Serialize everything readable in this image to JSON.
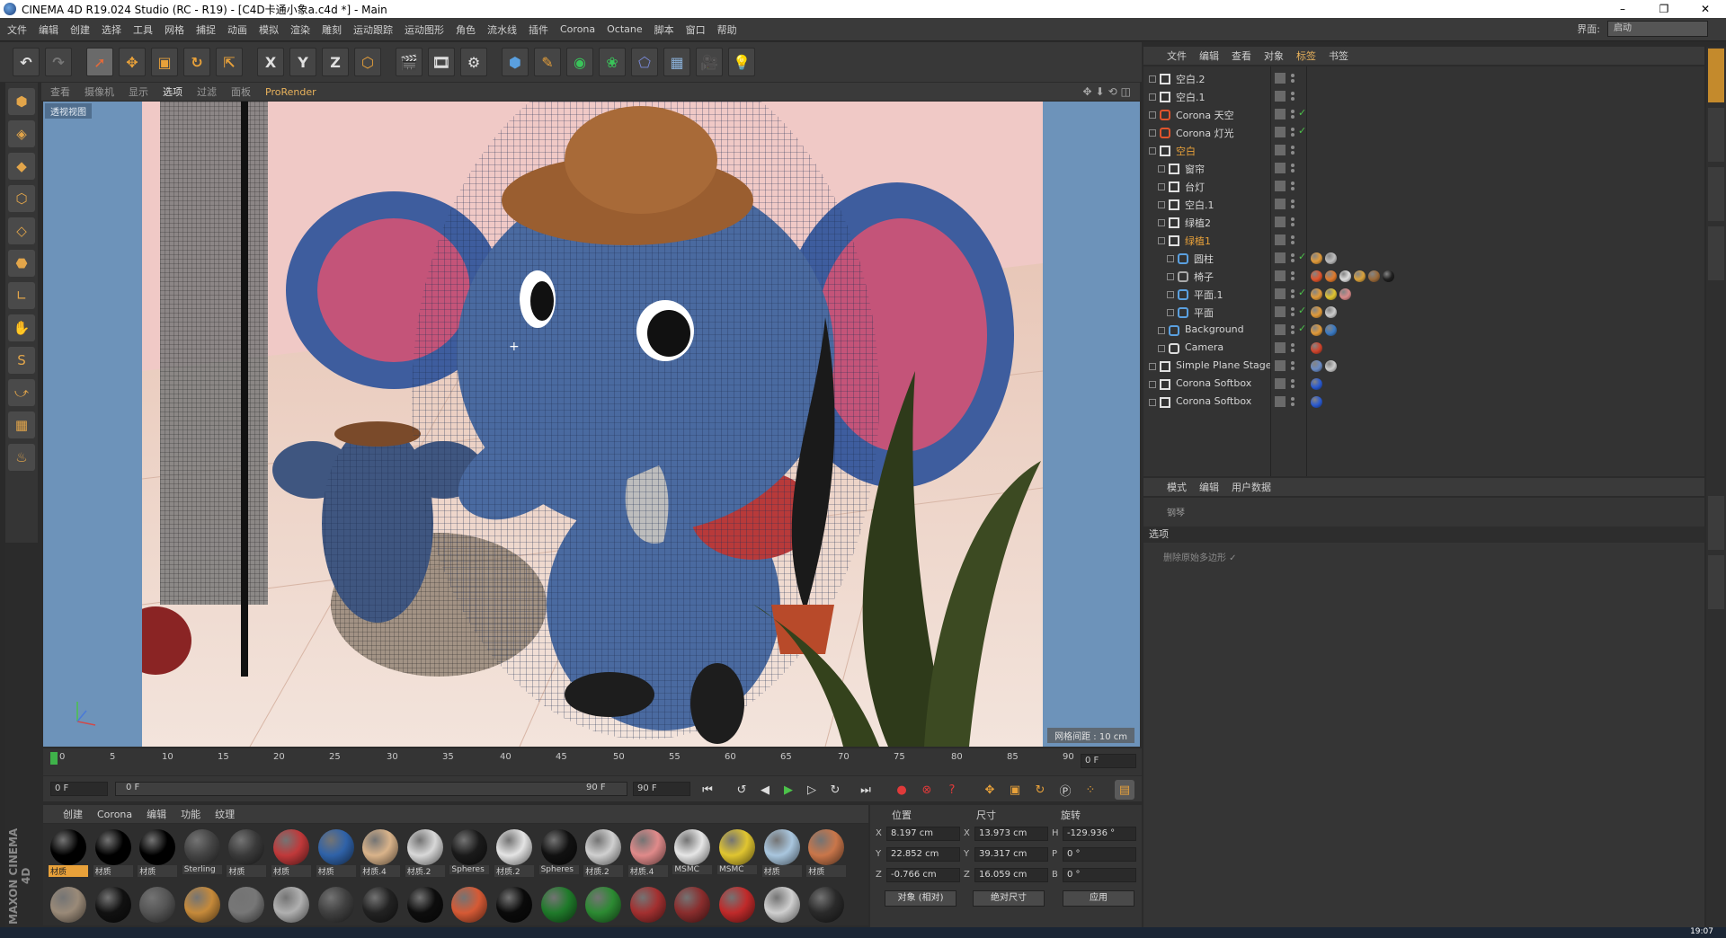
{
  "window": {
    "title": "CINEMA 4D R19.024 Studio (RC - R19) - [C4D卡通小象a.c4d *] - Main",
    "controls": [
      "–",
      "❐",
      "✕"
    ]
  },
  "menubar": {
    "items": [
      "文件",
      "编辑",
      "创建",
      "选择",
      "工具",
      "网格",
      "捕捉",
      "动画",
      "模拟",
      "渲染",
      "雕刻",
      "运动跟踪",
      "运动图形",
      "角色",
      "流水线",
      "插件",
      "Corona",
      "Octane",
      "脚本",
      "窗口",
      "帮助"
    ],
    "layout_label": "界面:",
    "layout_value": "启动"
  },
  "toolbar": {
    "buttons": [
      "↶",
      "↷",
      "➚",
      "✥",
      "▣",
      "↻",
      "⇱",
      "X",
      "Y",
      "Z",
      "⬡",
      "🎬",
      "🎞",
      "⚙",
      "⬢",
      "✎",
      "◉",
      "❀",
      "⬠",
      "▦",
      "🎥",
      "💡"
    ]
  },
  "left_tools": [
    "⬢",
    "◈",
    "◆",
    "⬡",
    "◇",
    "⬣",
    "∟",
    "✋",
    "S",
    "⤻",
    "▦",
    "♨"
  ],
  "viewport": {
    "menu": [
      "查看",
      "摄像机",
      "显示",
      "选项",
      "过滤",
      "面板",
      "ProRender"
    ],
    "active_menu": "选项",
    "label": "透视视图",
    "grid_info": "网格间距 : 10 cm",
    "nav_icons": "✥⬇⟲◫"
  },
  "timeline": {
    "ticks": [
      "0",
      "5",
      "10",
      "15",
      "20",
      "25",
      "30",
      "35",
      "40",
      "45",
      "50",
      "55",
      "60",
      "65",
      "70",
      "75",
      "80",
      "85",
      "90"
    ],
    "current_frame": "0 F"
  },
  "playback": {
    "start_field": "0 F",
    "range_start": "0 F",
    "range_end": "90 F",
    "end_field": "90 F"
  },
  "material_manager": {
    "tabs": [
      "创建",
      "Corona",
      "编辑",
      "功能",
      "纹理"
    ],
    "materials": [
      {
        "name": "材质",
        "color": "#000000",
        "selected": true
      },
      {
        "name": "材质",
        "color": "#000000",
        "selected": false
      },
      {
        "name": "材质",
        "color": "#000000",
        "selected": false
      },
      {
        "name": "Sterling",
        "color": "#444444",
        "selected": false
      },
      {
        "name": "材质",
        "color": "#3a3a3a",
        "selected": false
      },
      {
        "name": "材质",
        "color": "#c0393a",
        "selected": false
      },
      {
        "name": "材质",
        "color": "#2f62a8",
        "selected": false
      },
      {
        "name": "材质.4",
        "color": "#d9b38a",
        "selected": false
      },
      {
        "name": "材质.2",
        "color": "#d8d8d8",
        "selected": false
      },
      {
        "name": "Spheres",
        "color": "#1a1a1a",
        "selected": false
      },
      {
        "name": "材质.2",
        "color": "#e4e4e4",
        "selected": false
      },
      {
        "name": "Spheres",
        "color": "#111111",
        "selected": false
      },
      {
        "name": "材质.2",
        "color": "#d0d0d0",
        "selected": false
      },
      {
        "name": "材质.4",
        "color": "#e08a8a",
        "selected": false
      },
      {
        "name": "MSMC",
        "color": "#e6e6e6",
        "selected": false
      },
      {
        "name": "MSMC",
        "color": "#e0c530",
        "selected": false
      },
      {
        "name": "材质",
        "color": "#a9c6de",
        "selected": false
      },
      {
        "name": "材质",
        "color": "#c9764a",
        "selected": false
      }
    ],
    "second_row_colors": [
      "#9a8a78",
      "#111111",
      "#555555",
      "#c68a3a",
      "#777777",
      "#b0b0b0",
      "#404040",
      "#222222",
      "#0d0d0d",
      "#d65a35",
      "#0a0a0a",
      "#1f7a2a",
      "#2c8a32",
      "#a33030",
      "#8a2d2d",
      "#c02a2a",
      "#cfcfcf",
      "#2a2a2a"
    ],
    "brand": "MAXON CINEMA 4D"
  },
  "coordinates": {
    "headers": {
      "position": "位置",
      "size": "尺寸",
      "rotation": "旋转"
    },
    "rows": [
      {
        "label": "X",
        "position": "8.197 cm",
        "size_label": "X",
        "size": "13.973 cm",
        "rot_label": "H",
        "rotation": "-129.936 °"
      },
      {
        "label": "Y",
        "position": "22.852 cm",
        "size_label": "Y",
        "size": "39.317 cm",
        "rot_label": "P",
        "rotation": "0 °"
      },
      {
        "label": "Z",
        "position": "-0.766 cm",
        "size_label": "Z",
        "size": "16.059 cm",
        "rot_label": "B",
        "rotation": "0 °"
      }
    ],
    "mode_select": "对象 (相对)",
    "size_select": "绝对尺寸",
    "apply_button": "应用"
  },
  "object_manager": {
    "tabs": [
      "文件",
      "编辑",
      "查看",
      "对象",
      "标签",
      "书签"
    ],
    "active_tab": "标签",
    "objects": [
      {
        "name": "空白.2",
        "indent": 0,
        "icon": "null-icon",
        "selected": false,
        "tick": false,
        "tags": []
      },
      {
        "name": "空白.1",
        "indent": 0,
        "icon": "null-icon",
        "selected": false,
        "tick": false,
        "tags": []
      },
      {
        "name": "Corona 天空",
        "indent": 0,
        "icon": "sky-icon",
        "selected": false,
        "tick": true,
        "tags": []
      },
      {
        "name": "Corona 灯光",
        "indent": 0,
        "icon": "light-icon",
        "selected": false,
        "tick": true,
        "tags": []
      },
      {
        "name": "空白",
        "indent": 0,
        "icon": "null-icon",
        "selected": true,
        "tick": false,
        "tags": []
      },
      {
        "name": "窗帘",
        "indent": 1,
        "icon": "null-icon",
        "selected": false,
        "tick": false,
        "tags": []
      },
      {
        "name": "台灯",
        "indent": 1,
        "icon": "null-icon",
        "selected": false,
        "tick": false,
        "tags": []
      },
      {
        "name": "空白.1",
        "indent": 1,
        "icon": "null-icon",
        "selected": false,
        "tick": false,
        "tags": []
      },
      {
        "name": "绿植2",
        "indent": 1,
        "icon": "null-icon",
        "selected": false,
        "tick": false,
        "tags": []
      },
      {
        "name": "绿植1",
        "indent": 1,
        "icon": "null-icon",
        "selected": true,
        "tick": false,
        "tags": []
      },
      {
        "name": "圆柱",
        "indent": 2,
        "icon": "cylinder-icon",
        "selected": false,
        "tick": true,
        "tags": [
          "#e09a3a",
          "#bdbdbd"
        ]
      },
      {
        "name": "椅子",
        "indent": 2,
        "icon": "bone-icon",
        "selected": false,
        "tick": false,
        "tags": [
          "#e0542c",
          "#e07a2c",
          "#dddddd",
          "#d9a13a",
          "#9a6a3a",
          "#1e1e1e"
        ]
      },
      {
        "name": "平面.1",
        "indent": 2,
        "icon": "plane-icon",
        "selected": false,
        "tick": true,
        "tags": [
          "#e09a3a",
          "#e0c530",
          "#d88a8a"
        ]
      },
      {
        "name": "平面",
        "indent": 2,
        "icon": "plane-icon",
        "selected": false,
        "tick": true,
        "tags": [
          "#e09a3a",
          "#cccccc"
        ]
      },
      {
        "name": "Background",
        "indent": 1,
        "icon": "background-icon",
        "selected": false,
        "tick": true,
        "tags": [
          "#e09a3a",
          "#3a7ac4"
        ]
      },
      {
        "name": "Camera",
        "indent": 1,
        "icon": "camera-icon",
        "selected": false,
        "tick": false,
        "tags": [
          "#d0442c"
        ]
      },
      {
        "name": "Simple Plane Stage",
        "indent": 0,
        "icon": "null-icon",
        "selected": false,
        "tick": false,
        "tags": [
          "#6a8ac4",
          "#cccccc"
        ]
      },
      {
        "name": "Corona Softbox",
        "indent": 0,
        "icon": "null-icon",
        "selected": false,
        "tick": false,
        "tags": [
          "#2a5ad0"
        ]
      },
      {
        "name": "Corona Softbox",
        "indent": 0,
        "icon": "null-icon",
        "selected": false,
        "tick": false,
        "tags": [
          "#2a5ad0"
        ]
      }
    ]
  },
  "attribute_manager": {
    "tabs": [
      "模式",
      "编辑",
      "用户数据"
    ],
    "title": "钢琴",
    "section": "选项",
    "option": "删除原始多边形 ✓"
  },
  "status": {
    "clock": "19:07"
  }
}
